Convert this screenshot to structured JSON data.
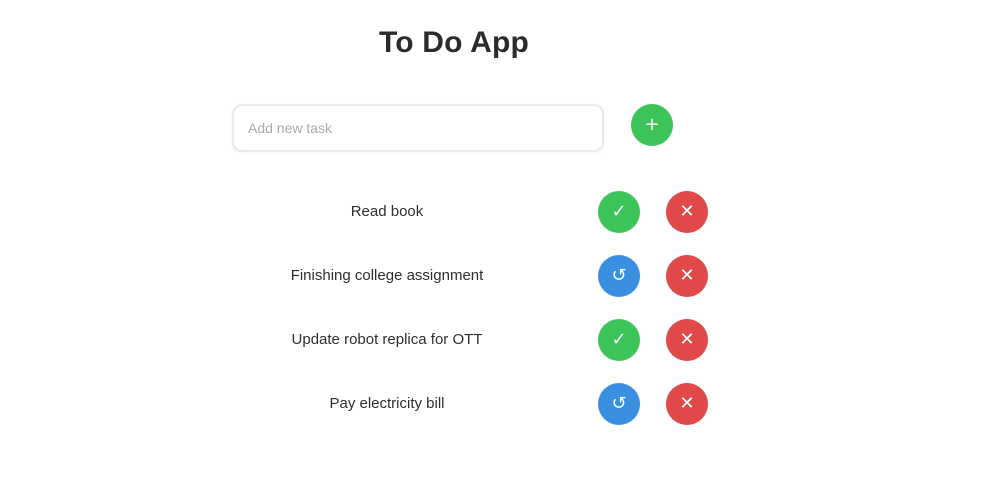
{
  "app": {
    "title": "To Do App"
  },
  "new_task": {
    "placeholder": "Add new task",
    "value": ""
  },
  "add_button": {
    "icon": "plus-icon",
    "color": "#3cc45a"
  },
  "colors": {
    "complete_green": "#3cc45a",
    "pending_blue": "#3a8fe0",
    "delete_red": "#e0484a"
  },
  "tasks": [
    {
      "text": "Read book",
      "status": "complete",
      "status_icon": "check-icon",
      "status_color": "#3cc45a",
      "delete_icon": "trash-icon"
    },
    {
      "text": "Finishing college assignment",
      "status": "pending",
      "status_icon": "undo-icon",
      "status_color": "#3a8fe0",
      "delete_icon": "trash-icon"
    },
    {
      "text": "Update robot replica for OTT",
      "status": "complete",
      "status_icon": "check-icon",
      "status_color": "#3cc45a",
      "delete_icon": "trash-icon"
    },
    {
      "text": "Pay electricity bill",
      "status": "pending",
      "status_icon": "undo-icon",
      "status_color": "#3a8fe0",
      "delete_icon": "trash-icon"
    }
  ]
}
